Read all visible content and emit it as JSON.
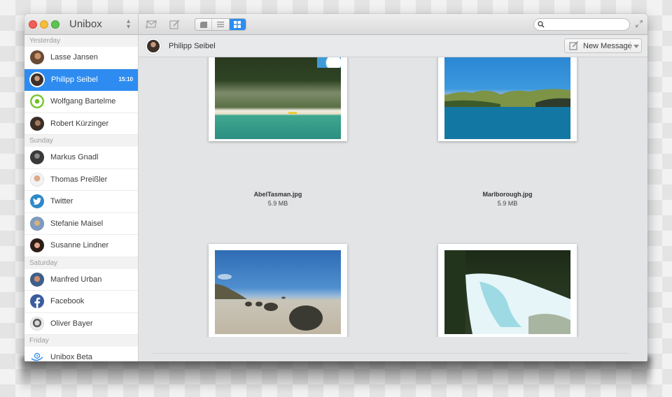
{
  "window": {
    "app_title": "Unibox"
  },
  "toolbar": {
    "search": {
      "value": "",
      "placeholder": ""
    },
    "view_modes": [
      "conversation",
      "list",
      "attachments"
    ],
    "active_view": "attachments",
    "accent_color": "#2e8cf0"
  },
  "sidebar": {
    "sections": [
      {
        "label": "Yesterday",
        "contacts": [
          {
            "name": "Lasse Jansen",
            "time": "",
            "avatar": "person-photo"
          },
          {
            "name": "Philipp Seibel",
            "time": "15:10",
            "avatar": "person-photo",
            "selected": true
          },
          {
            "name": "Wolfgang Bartelme",
            "time": "",
            "avatar": "bartelme-logo"
          },
          {
            "name": "Robert Kürzinger",
            "time": "",
            "avatar": "person-photo"
          }
        ]
      },
      {
        "label": "Sunday",
        "contacts": [
          {
            "name": "Markus Gnadl",
            "time": "",
            "avatar": "person-photo"
          },
          {
            "name": "Thomas Preißler",
            "time": "",
            "avatar": "person-photo"
          },
          {
            "name": "Twitter",
            "time": "",
            "avatar": "twitter-logo"
          },
          {
            "name": "Stefanie Maisel",
            "time": "",
            "avatar": "person-photo"
          },
          {
            "name": "Susanne Lindner",
            "time": "",
            "avatar": "person-photo"
          }
        ]
      },
      {
        "label": "Saturday",
        "contacts": [
          {
            "name": "Manfred Urban",
            "time": "",
            "avatar": "person-photo"
          },
          {
            "name": "Facebook",
            "time": "",
            "avatar": "facebook-logo"
          },
          {
            "name": "Oliver Bayer",
            "time": "",
            "avatar": "person-photo"
          }
        ]
      },
      {
        "label": "Friday",
        "contacts": [
          {
            "name": "Unibox Beta",
            "time": "",
            "avatar": "unibox-logo"
          }
        ]
      }
    ]
  },
  "conversation": {
    "contact_name": "Philipp Seibel",
    "new_message_label": "New Message",
    "attachments": [
      {
        "file_name": "AbelTasman.jpg",
        "size": "5.9 MB",
        "scene": "forest-beach"
      },
      {
        "file_name": "Marlborough.jpg",
        "size": "5.9 MB",
        "scene": "bay-hills"
      },
      {
        "file_name": "",
        "size": "",
        "scene": "boulders-beach"
      },
      {
        "file_name": "",
        "size": "",
        "scene": "waterfall"
      }
    ],
    "thumbnail_zoom": 0.55
  }
}
